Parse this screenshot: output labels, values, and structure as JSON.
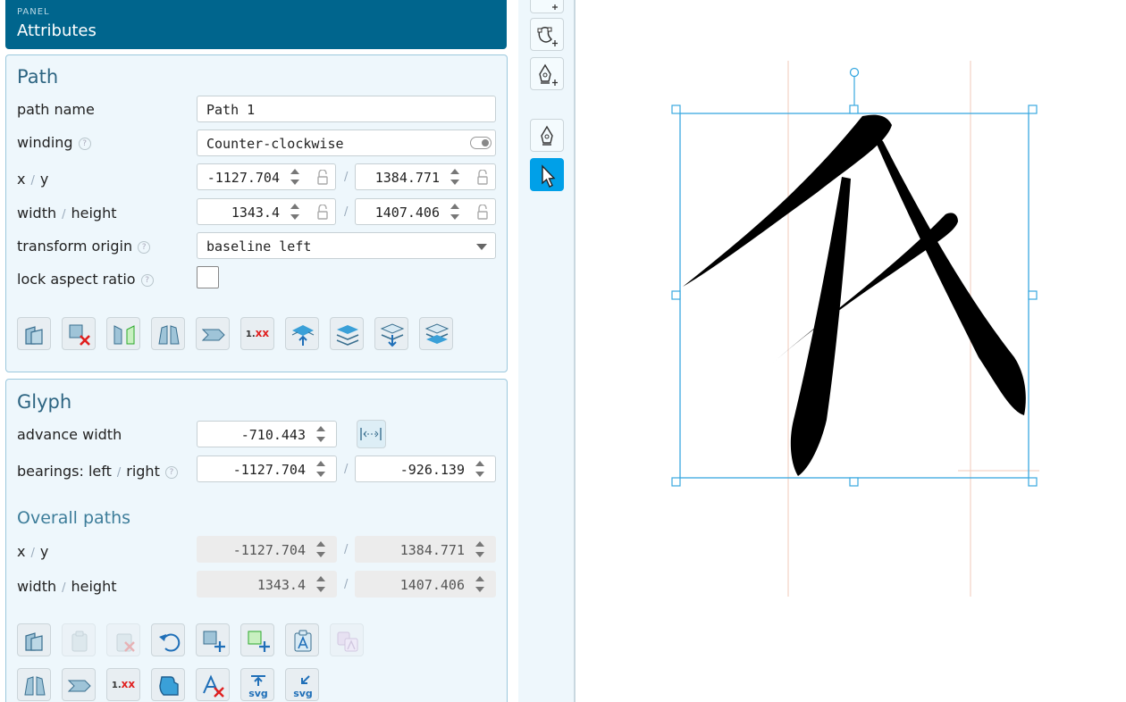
{
  "panel": {
    "label": "PANEL",
    "title": "Attributes"
  },
  "path": {
    "title": "Path",
    "name_label": "path name",
    "name_value": "Path 1",
    "winding_label": "winding",
    "winding_value": "Counter-clockwise",
    "xy_label_x": "x",
    "xy_label_y": "y",
    "x_value": "-1127.704",
    "y_value": "1384.771",
    "wh_label_w": "width",
    "wh_label_h": "height",
    "width_value": "1343.4",
    "height_value": "1407.406",
    "origin_label": "transform origin",
    "origin_value": "baseline left",
    "lock_label": "lock aspect ratio",
    "help_glyph": "?",
    "slash": "/"
  },
  "glyph": {
    "title": "Glyph",
    "advance_label": "advance width",
    "advance_value": "-710.443",
    "bearings_label_left": "bearings: left",
    "bearings_label_right": "right",
    "bearing_left_value": "-1127.704",
    "bearing_right_value": "-926.139"
  },
  "overall": {
    "title": "Overall paths",
    "x_value": "-1127.704",
    "y_value": "1384.771",
    "width_value": "1343.4",
    "height_value": "1407.406"
  },
  "toolbar_text": {
    "round_label": "1.xx",
    "svg_label": "svg"
  },
  "icons": {
    "path_toolbar": [
      "copy-path-icon",
      "delete-path-icon",
      "flip-horizontal-icon",
      "flip-vertical-icon",
      "skew-icon",
      "round-values-icon",
      "move-up-icon",
      "move-to-top-icon",
      "move-down-icon",
      "move-to-bottom-icon"
    ],
    "glyph_toolbar": [
      "copy-icon",
      "paste-icon",
      "clear-clipboard-icon",
      "undo-icon",
      "add-shape-icon",
      "add-component-icon",
      "paste-glyph-icon",
      "paste-glyph-component-icon",
      "flip-vertical-icon",
      "skew-icon",
      "round-values-icon",
      "combine-icon",
      "delete-glyph-icon",
      "export-svg-icon",
      "import-svg-icon"
    ],
    "vertical_tools": [
      "new-path-icon",
      "path-edit-icon",
      "pen-plus-icon",
      "pen-icon",
      "pointer-icon"
    ]
  },
  "colors": {
    "accent": "#00658d",
    "active_tool": "#00a0e8",
    "selection": "#38a8e0",
    "guide": "#f0c8b8"
  }
}
